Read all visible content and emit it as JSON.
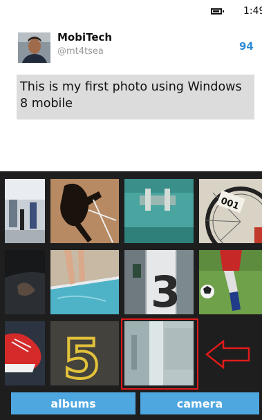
{
  "status_bar": {
    "time": "1:49",
    "battery_icon": "battery-icon"
  },
  "profile": {
    "name": "MobiTech",
    "handle": "@mt4tsea",
    "char_count": "94"
  },
  "compose": {
    "text": "This is my first photo using Windows 8 mobile"
  },
  "gallery": {
    "tiles": [
      {
        "name": "photo-office-hallway"
      },
      {
        "name": "photo-hopscotch-shadow"
      },
      {
        "name": "photo-teal-door-latch"
      },
      {
        "name": "photo-bicycle-wheel-001"
      },
      {
        "name": "photo-dark-swimmer"
      },
      {
        "name": "photo-pool-legs"
      },
      {
        "name": "photo-pillar-number-3"
      },
      {
        "name": "photo-soccer-player"
      },
      {
        "name": "photo-red-shoe"
      },
      {
        "name": "photo-number-5-pavement"
      },
      {
        "name": "photo-selected-blurry"
      }
    ],
    "tile_labels": {
      "bike": "001",
      "pillar": "3",
      "pavement": "5"
    },
    "selected_index": 10
  },
  "buttons": {
    "albums": "albums",
    "camera": "camera"
  },
  "colors": {
    "accent": "#4fa7e0",
    "highlight": "#e11a1a",
    "count": "#2d8bd6"
  }
}
